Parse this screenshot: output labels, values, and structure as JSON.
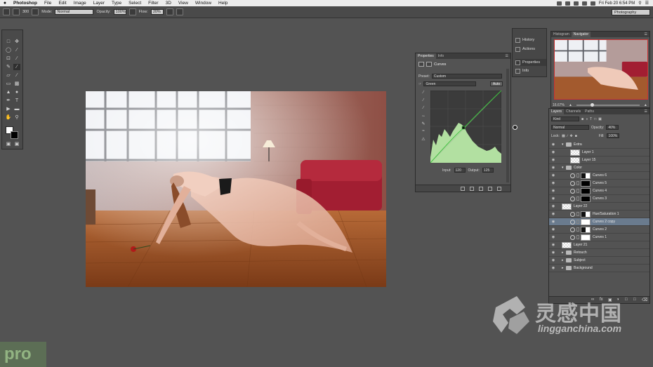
{
  "menubar": {
    "apple": "",
    "items": [
      "Photoshop",
      "File",
      "Edit",
      "Image",
      "Layer",
      "Type",
      "Select",
      "Filter",
      "3D",
      "View",
      "Window",
      "Help"
    ],
    "clock": "Fri Feb 20  6:54 PM"
  },
  "options": {
    "mode_label": "Mode:",
    "mode_value": "Normal",
    "opacity_label": "Opacity:",
    "opacity_value": "100%",
    "flow_label": "Flow:",
    "flow_value": "20%",
    "brush_size": "300",
    "workspace": "Photography"
  },
  "dock_mini": {
    "items": [
      {
        "label": "History"
      },
      {
        "label": "Actions"
      },
      {
        "label": "Properties"
      },
      {
        "label": "Info"
      }
    ]
  },
  "properties": {
    "tabs": [
      "Properties",
      "Info"
    ],
    "title": "Curves",
    "preset_label": "Preset:",
    "preset_value": "Custom",
    "channel_value": "Green",
    "auto_label": "Auto",
    "input_label": "Input:",
    "input_value": "120",
    "output_label": "Output:",
    "output_value": "125"
  },
  "navigator": {
    "tabs": [
      "Histogram",
      "Navigator"
    ],
    "zoom": "16.67%"
  },
  "layers": {
    "tabs": [
      "Layers",
      "Channels",
      "Paths"
    ],
    "kind_label": "Kind",
    "blend_mode": "Normal",
    "opacity_label": "Opacity:",
    "opacity_value": "40%",
    "lock_label": "Lock:",
    "fill_label": "Fill:",
    "fill_value": "100%",
    "rows": [
      {
        "name": "Extra",
        "kind": "group-open"
      },
      {
        "name": "Layer 1",
        "kind": "checker-in"
      },
      {
        "name": "Layer 15",
        "kind": "checker-in"
      },
      {
        "name": "Color",
        "kind": "group-open"
      },
      {
        "name": "Curves 6",
        "kind": "adj-mixed"
      },
      {
        "name": "Curves 5",
        "kind": "adj-black"
      },
      {
        "name": "Curves 4",
        "kind": "adj-black"
      },
      {
        "name": "Curves 3",
        "kind": "adj-black"
      },
      {
        "name": "Layer 22",
        "kind": "checker"
      },
      {
        "name": "Hue/Saturation 1",
        "kind": "adj-mixed"
      },
      {
        "name": "Curves 2 copy",
        "kind": "adj-white",
        "selected": true
      },
      {
        "name": "Curves 2",
        "kind": "adj-mixed"
      },
      {
        "name": "Curves 1",
        "kind": "adj-white"
      },
      {
        "name": "Layer 21",
        "kind": "checker"
      },
      {
        "name": "Retouch",
        "kind": "group"
      },
      {
        "name": "Subject",
        "kind": "group"
      },
      {
        "name": "Background",
        "kind": "group"
      }
    ]
  },
  "watermark": {
    "cn": "灵感中国",
    "en": "lingganchina.com",
    "pro": "pro"
  }
}
